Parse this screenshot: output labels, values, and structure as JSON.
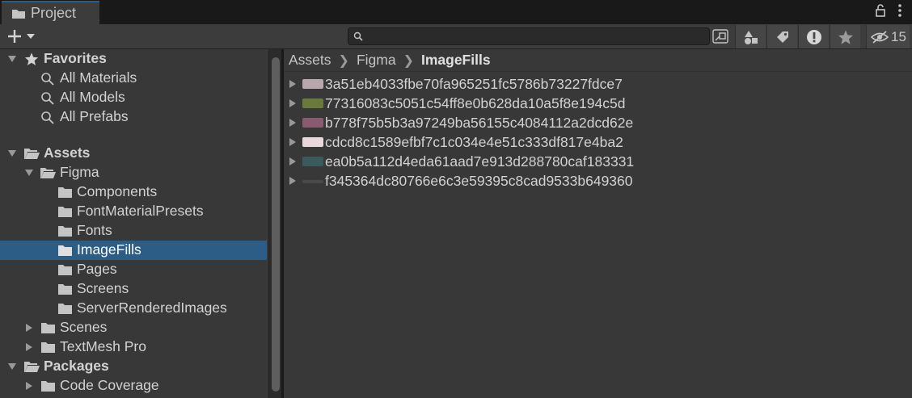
{
  "window": {
    "tab_title": "Project"
  },
  "toolbar": {
    "search": {
      "value": "",
      "placeholder": ""
    },
    "hidden_packages_count": "15",
    "buttons": [
      "create-button",
      "search-by-type",
      "search-by-label",
      "show-errors",
      "favorites",
      "toggle-hidden-packages"
    ]
  },
  "tree": {
    "favorites": {
      "label": "Favorites",
      "items": [
        "All Materials",
        "All Models",
        "All Prefabs"
      ]
    },
    "assets": {
      "label": "Assets",
      "figma": {
        "label": "Figma",
        "children": [
          "Components",
          "FontMaterialPresets",
          "Fonts",
          "ImageFills",
          "Pages",
          "Screens",
          "ServerRenderedImages"
        ],
        "selected": "ImageFills"
      },
      "scenes": "Scenes",
      "textmesh": "TextMesh Pro"
    },
    "packages": {
      "label": "Packages",
      "children": [
        "Code Coverage"
      ]
    }
  },
  "breadcrumb": [
    "Assets",
    "Figma",
    "ImageFills"
  ],
  "files": [
    {
      "name": "3a51eb4033fbe70fa965251fc5786b73227fdce7",
      "thumb_color": "#b8a8ae"
    },
    {
      "name": "77316083c5051c54ff8e0b628da10a5f8e194c5d",
      "thumb_color": "#6a7a3c"
    },
    {
      "name": "b778f75b5b3a97249ba56155c4084112a2dcd62e",
      "thumb_color": "#8a5a6e"
    },
    {
      "name": "cdcd8c1589efbf7c1c034e4e51c333df817e4ba2",
      "thumb_color": "#e8d8dc"
    },
    {
      "name": "ea0b5a112d4eda61aad7e913d288780caf183331",
      "thumb_color": "#3a5a5e"
    },
    {
      "name": "f345364dc80766e6c3e59395c8cad9533b649360",
      "thumb_color": "#4a4a4a"
    }
  ],
  "colors": {
    "selection": "#2c5d87",
    "pane_bg": "#383838",
    "toolbar_bg": "#3c3c3c"
  }
}
